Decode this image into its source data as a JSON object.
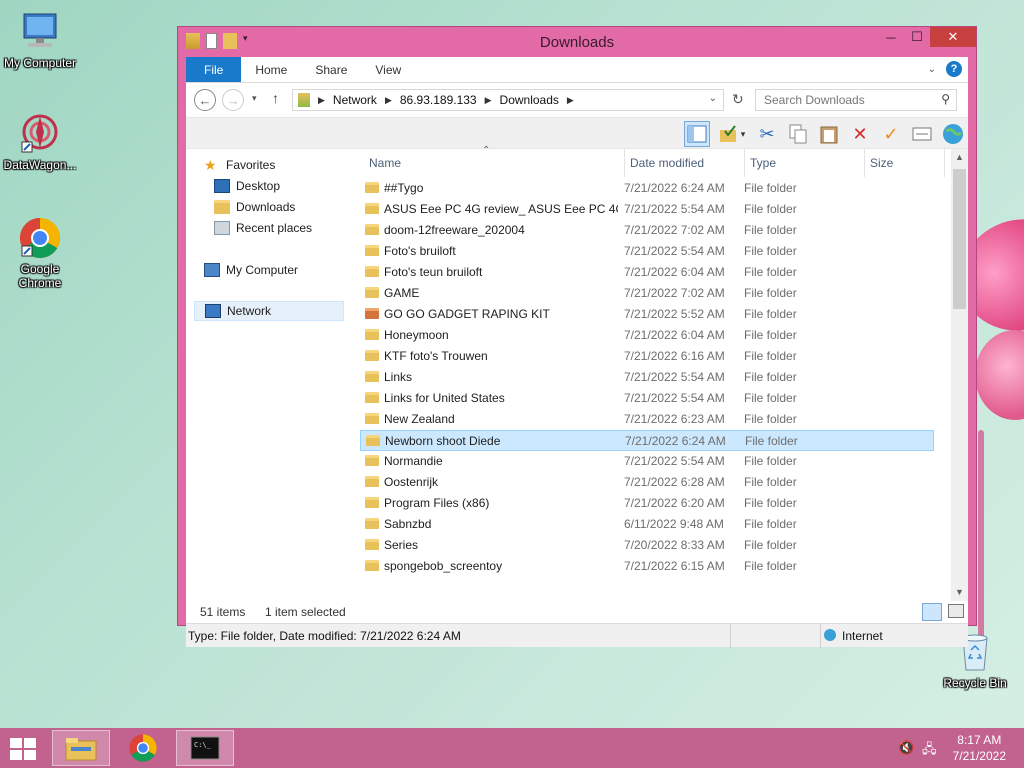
{
  "desktop": {
    "icons": [
      {
        "label": "My Computer",
        "icon": "my-computer-icon"
      },
      {
        "label": "DataWagon...",
        "icon": "datawagon-icon"
      },
      {
        "label": "Google Chrome",
        "icon": "chrome-icon"
      },
      {
        "label": "Recycle Bin",
        "icon": "recycle-bin-icon"
      }
    ]
  },
  "window": {
    "title": "Downloads",
    "controls": {
      "minimize": "─",
      "maximize": "☐",
      "close": "✕"
    },
    "ribbon_tabs": [
      "File",
      "Home",
      "Share",
      "View"
    ],
    "address": {
      "crumbs": [
        "Network",
        "86.93.189.133",
        "Downloads"
      ]
    },
    "search": {
      "placeholder": "Search Downloads"
    },
    "nav_pane": {
      "favorites": "Favorites",
      "items": [
        "Desktop",
        "Downloads",
        "Recent places"
      ],
      "my_computer": "My Computer",
      "network": "Network"
    },
    "columns": [
      "Name",
      "Date modified",
      "Type",
      "Size"
    ],
    "files": [
      {
        "name": "##Tygo",
        "date": "7/21/2022 6:24 AM",
        "type": "File folder"
      },
      {
        "name": "ASUS Eee PC 4G review_ ASUS Eee PC 4G ...",
        "date": "7/21/2022 5:54 AM",
        "type": "File folder"
      },
      {
        "name": "doom-12freeware_202004",
        "date": "7/21/2022 7:02 AM",
        "type": "File folder"
      },
      {
        "name": "Foto's bruiloft",
        "date": "7/21/2022 5:54 AM",
        "type": "File folder"
      },
      {
        "name": "Foto's teun bruiloft",
        "date": "7/21/2022 6:04 AM",
        "type": "File folder"
      },
      {
        "name": "GAME",
        "date": "7/21/2022 7:02 AM",
        "type": "File folder"
      },
      {
        "name": "GO GO GADGET RAPING KIT",
        "date": "7/21/2022 5:52 AM",
        "type": "File folder"
      },
      {
        "name": "Honeymoon",
        "date": "7/21/2022 6:04 AM",
        "type": "File folder"
      },
      {
        "name": "KTF foto's Trouwen",
        "date": "7/21/2022 6:16 AM",
        "type": "File folder"
      },
      {
        "name": "Links",
        "date": "7/21/2022 5:54 AM",
        "type": "File folder"
      },
      {
        "name": "Links for United States",
        "date": "7/21/2022 5:54 AM",
        "type": "File folder"
      },
      {
        "name": "New Zealand",
        "date": "7/21/2022 6:23 AM",
        "type": "File folder"
      },
      {
        "name": "Newborn shoot Diede",
        "date": "7/21/2022 6:24 AM",
        "type": "File folder",
        "selected": true
      },
      {
        "name": "Normandie",
        "date": "7/21/2022 5:54 AM",
        "type": "File folder"
      },
      {
        "name": "Oostenrijk",
        "date": "7/21/2022 6:28 AM",
        "type": "File folder"
      },
      {
        "name": "Program Files (x86)",
        "date": "7/21/2022 6:20 AM",
        "type": "File folder"
      },
      {
        "name": "Sabnzbd",
        "date": "6/11/2022 9:48 AM",
        "type": "File folder"
      },
      {
        "name": "Series",
        "date": "7/20/2022 8:33 AM",
        "type": "File folder"
      },
      {
        "name": "spongebob_screentoy",
        "date": "7/21/2022 6:15 AM",
        "type": "File folder"
      }
    ],
    "status": {
      "item_count": "51 items",
      "selection": "1 item selected",
      "details": "Type: File folder, Date modified: 7/21/2022 6:24 AM",
      "zone": "Internet"
    }
  },
  "taskbar": {
    "time": "8:17 AM",
    "date": "7/21/2022"
  }
}
